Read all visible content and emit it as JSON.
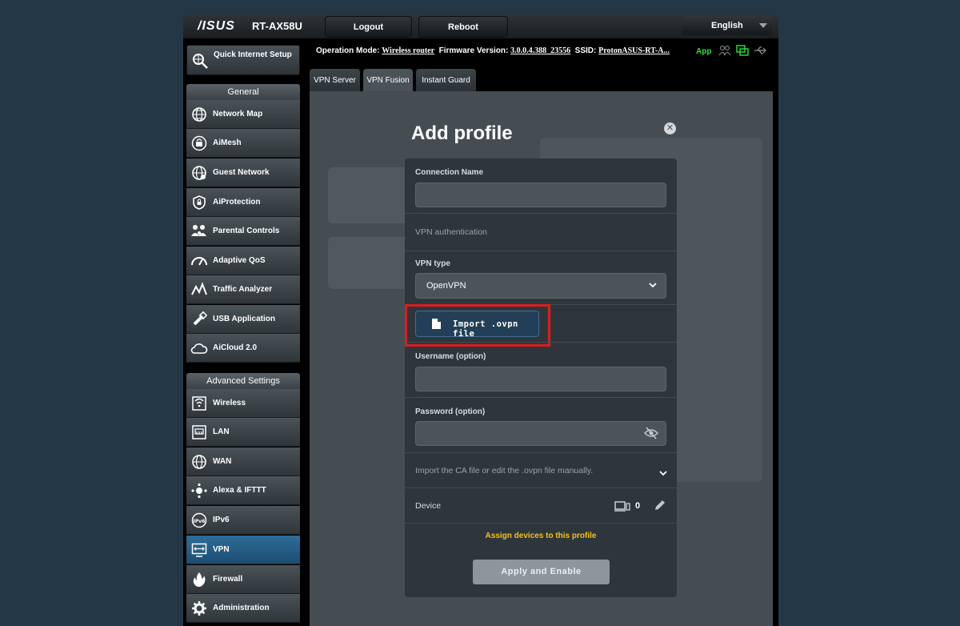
{
  "header": {
    "logo": "/ISUS",
    "model": "RT-AX58U",
    "logout_label": "Logout",
    "reboot_label": "Reboot",
    "language": "English"
  },
  "status_bar": {
    "operation_mode_label": "Operation Mode:",
    "operation_mode_value": "Wireless router",
    "firmware_label": "Firmware Version:",
    "firmware_value": "3.0.0.4.388_23556",
    "ssid_label": "SSID:",
    "ssid_value": "ProtonASUS-RT-A...",
    "app_label": "App"
  },
  "sidebar": {
    "quick_setup": "Quick Internet Setup",
    "general_title": "General",
    "general_items": [
      {
        "label": "Network Map",
        "icon": "globe-icon"
      },
      {
        "label": "AiMesh",
        "icon": "mesh-icon"
      },
      {
        "label": "Guest Network",
        "icon": "guest-globe-icon"
      },
      {
        "label": "AiProtection",
        "icon": "shield-icon"
      },
      {
        "label": "Parental Controls",
        "icon": "family-icon"
      },
      {
        "label": "Adaptive QoS",
        "icon": "gauge-icon"
      },
      {
        "label": "Traffic Analyzer",
        "icon": "analyzer-icon"
      },
      {
        "label": "USB Application",
        "icon": "usb-icon"
      },
      {
        "label": "AiCloud 2.0",
        "icon": "cloud-icon"
      }
    ],
    "advanced_title": "Advanced Settings",
    "advanced_items": [
      {
        "label": "Wireless",
        "icon": "wifi-icon"
      },
      {
        "label": "LAN",
        "icon": "lan-icon"
      },
      {
        "label": "WAN",
        "icon": "wan-globe-icon"
      },
      {
        "label": "Alexa & IFTTT",
        "icon": "alexa-icon"
      },
      {
        "label": "IPv6",
        "icon": "ipv6-icon"
      },
      {
        "label": "VPN",
        "icon": "vpn-icon",
        "active": true
      },
      {
        "label": "Firewall",
        "icon": "firewall-icon"
      },
      {
        "label": "Administration",
        "icon": "admin-gear-icon"
      }
    ]
  },
  "tabs": [
    "VPN Server",
    "VPN Fusion",
    "Instant Guard"
  ],
  "modal": {
    "title": "Add profile",
    "connection_name_label": "Connection Name",
    "connection_name_value": "",
    "vpn_auth_label": "VPN authentication",
    "vpn_type_label": "VPN type",
    "vpn_type_value": "OpenVPN",
    "import_label": "Import .ovpn file",
    "username_label": "Username (option)",
    "username_value": "",
    "password_label": "Password (option)",
    "password_value": "",
    "ca_label": "Import the CA file or edit the .ovpn file manually.",
    "device_label": "Device",
    "device_count": "0",
    "assign_label": "Assign devices to this profile",
    "apply_label": "Apply and Enable"
  },
  "colors": {
    "highlight": "#e01c1c",
    "assign": "#f3c21c",
    "app": "#27e43b",
    "active_menu": "#2d6d98"
  }
}
